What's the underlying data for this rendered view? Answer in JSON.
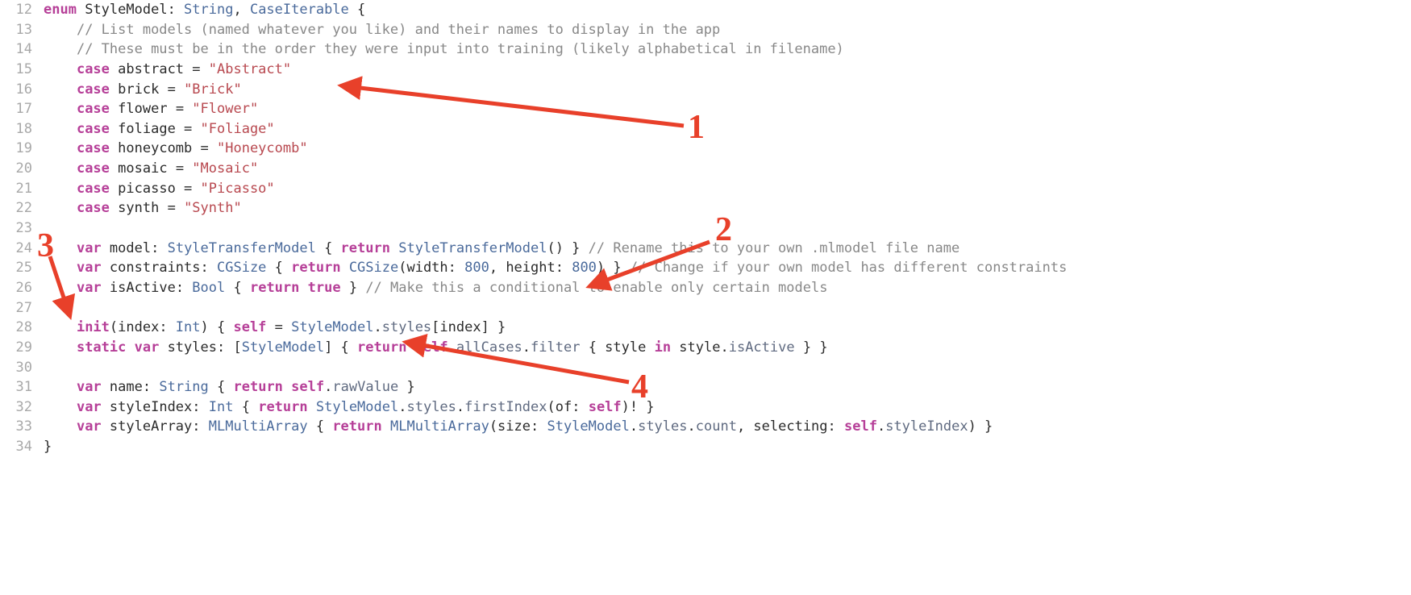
{
  "annotations": {
    "n1": "1",
    "n2": "2",
    "n3": "3",
    "n4": "4"
  },
  "colors": {
    "annotation": "#e8402a",
    "keyword": "#b63f98",
    "type": "#4a6a9b",
    "string": "#b8484f",
    "comment": "#888888"
  },
  "lines": [
    {
      "n": "12",
      "tokens": [
        {
          "c": "kw",
          "t": "enum"
        },
        {
          "c": "",
          "t": " "
        },
        {
          "c": "ident",
          "t": "StyleModel"
        },
        {
          "c": "",
          "t": ": "
        },
        {
          "c": "type",
          "t": "String"
        },
        {
          "c": "",
          "t": ", "
        },
        {
          "c": "type",
          "t": "CaseIterable"
        },
        {
          "c": "",
          "t": " {"
        }
      ]
    },
    {
      "n": "13",
      "indent": "    ",
      "tokens": [
        {
          "c": "comment",
          "t": "// List models (named whatever you like) and their names to display in the app"
        }
      ]
    },
    {
      "n": "14",
      "indent": "    ",
      "tokens": [
        {
          "c": "comment",
          "t": "// These must be in the order they were input into training (likely alphabetical in filename)"
        }
      ]
    },
    {
      "n": "15",
      "indent": "    ",
      "tokens": [
        {
          "c": "kw",
          "t": "case"
        },
        {
          "c": "",
          "t": " "
        },
        {
          "c": "ident",
          "t": "abstract"
        },
        {
          "c": "",
          "t": " = "
        },
        {
          "c": "str",
          "t": "\"Abstract\""
        }
      ]
    },
    {
      "n": "16",
      "indent": "    ",
      "tokens": [
        {
          "c": "kw",
          "t": "case"
        },
        {
          "c": "",
          "t": " "
        },
        {
          "c": "ident",
          "t": "brick"
        },
        {
          "c": "",
          "t": " = "
        },
        {
          "c": "str",
          "t": "\"Brick\""
        }
      ]
    },
    {
      "n": "17",
      "indent": "    ",
      "tokens": [
        {
          "c": "kw",
          "t": "case"
        },
        {
          "c": "",
          "t": " "
        },
        {
          "c": "ident",
          "t": "flower"
        },
        {
          "c": "",
          "t": " = "
        },
        {
          "c": "str",
          "t": "\"Flower\""
        }
      ]
    },
    {
      "n": "18",
      "indent": "    ",
      "tokens": [
        {
          "c": "kw",
          "t": "case"
        },
        {
          "c": "",
          "t": " "
        },
        {
          "c": "ident",
          "t": "foliage"
        },
        {
          "c": "",
          "t": " = "
        },
        {
          "c": "str",
          "t": "\"Foliage\""
        }
      ]
    },
    {
      "n": "19",
      "indent": "    ",
      "tokens": [
        {
          "c": "kw",
          "t": "case"
        },
        {
          "c": "",
          "t": " "
        },
        {
          "c": "ident",
          "t": "honeycomb"
        },
        {
          "c": "",
          "t": " = "
        },
        {
          "c": "str",
          "t": "\"Honeycomb\""
        }
      ]
    },
    {
      "n": "20",
      "indent": "    ",
      "tokens": [
        {
          "c": "kw",
          "t": "case"
        },
        {
          "c": "",
          "t": " "
        },
        {
          "c": "ident",
          "t": "mosaic"
        },
        {
          "c": "",
          "t": " = "
        },
        {
          "c": "str",
          "t": "\"Mosaic\""
        }
      ]
    },
    {
      "n": "21",
      "indent": "    ",
      "tokens": [
        {
          "c": "kw",
          "t": "case"
        },
        {
          "c": "",
          "t": " "
        },
        {
          "c": "ident",
          "t": "picasso"
        },
        {
          "c": "",
          "t": " = "
        },
        {
          "c": "str",
          "t": "\"Picasso\""
        }
      ]
    },
    {
      "n": "22",
      "indent": "    ",
      "tokens": [
        {
          "c": "kw",
          "t": "case"
        },
        {
          "c": "",
          "t": " "
        },
        {
          "c": "ident",
          "t": "synth"
        },
        {
          "c": "",
          "t": " = "
        },
        {
          "c": "str",
          "t": "\"Synth\""
        }
      ]
    },
    {
      "n": "23",
      "indent": "",
      "tokens": [
        {
          "c": "",
          "t": ""
        }
      ]
    },
    {
      "n": "24",
      "indent": "    ",
      "tokens": [
        {
          "c": "kw",
          "t": "var"
        },
        {
          "c": "",
          "t": " "
        },
        {
          "c": "ident",
          "t": "model"
        },
        {
          "c": "",
          "t": ": "
        },
        {
          "c": "type",
          "t": "StyleTransferModel"
        },
        {
          "c": "",
          "t": " { "
        },
        {
          "c": "kw",
          "t": "return"
        },
        {
          "c": "",
          "t": " "
        },
        {
          "c": "type",
          "t": "StyleTransferModel"
        },
        {
          "c": "",
          "t": "() } "
        },
        {
          "c": "comment",
          "t": "// Rename this to your own .mlmodel file name"
        }
      ]
    },
    {
      "n": "25",
      "indent": "    ",
      "tokens": [
        {
          "c": "kw",
          "t": "var"
        },
        {
          "c": "",
          "t": " "
        },
        {
          "c": "ident",
          "t": "constraints"
        },
        {
          "c": "",
          "t": ": "
        },
        {
          "c": "type",
          "t": "CGSize"
        },
        {
          "c": "",
          "t": " { "
        },
        {
          "c": "kw",
          "t": "return"
        },
        {
          "c": "",
          "t": " "
        },
        {
          "c": "type",
          "t": "CGSize"
        },
        {
          "c": "",
          "t": "(width: "
        },
        {
          "c": "num",
          "t": "800"
        },
        {
          "c": "",
          "t": ", height: "
        },
        {
          "c": "num",
          "t": "800"
        },
        {
          "c": "",
          "t": ") } "
        },
        {
          "c": "comment",
          "t": "// Change if your own model has different constraints"
        }
      ]
    },
    {
      "n": "26",
      "indent": "    ",
      "tokens": [
        {
          "c": "kw",
          "t": "var"
        },
        {
          "c": "",
          "t": " "
        },
        {
          "c": "ident",
          "t": "isActive"
        },
        {
          "c": "",
          "t": ": "
        },
        {
          "c": "type",
          "t": "Bool"
        },
        {
          "c": "",
          "t": " { "
        },
        {
          "c": "kw",
          "t": "return"
        },
        {
          "c": "",
          "t": " "
        },
        {
          "c": "bool",
          "t": "true"
        },
        {
          "c": "",
          "t": " } "
        },
        {
          "c": "comment",
          "t": "// Make this a conditional to enable only certain models"
        }
      ]
    },
    {
      "n": "27",
      "indent": "",
      "tokens": [
        {
          "c": "",
          "t": ""
        }
      ]
    },
    {
      "n": "28",
      "indent": "    ",
      "tokens": [
        {
          "c": "kw",
          "t": "init"
        },
        {
          "c": "",
          "t": "(index: "
        },
        {
          "c": "type",
          "t": "Int"
        },
        {
          "c": "",
          "t": ") { "
        },
        {
          "c": "kw",
          "t": "self"
        },
        {
          "c": "",
          "t": " = "
        },
        {
          "c": "type",
          "t": "StyleModel"
        },
        {
          "c": "",
          "t": "."
        },
        {
          "c": "member",
          "t": "styles"
        },
        {
          "c": "",
          "t": "[index] }"
        }
      ]
    },
    {
      "n": "29",
      "indent": "    ",
      "tokens": [
        {
          "c": "kw",
          "t": "static var"
        },
        {
          "c": "",
          "t": " "
        },
        {
          "c": "ident",
          "t": "styles"
        },
        {
          "c": "",
          "t": ": ["
        },
        {
          "c": "type",
          "t": "StyleModel"
        },
        {
          "c": "",
          "t": "] { "
        },
        {
          "c": "kw",
          "t": "return"
        },
        {
          "c": "",
          "t": " "
        },
        {
          "c": "kw",
          "t": "self"
        },
        {
          "c": "",
          "t": "."
        },
        {
          "c": "member",
          "t": "allCases"
        },
        {
          "c": "",
          "t": "."
        },
        {
          "c": "member",
          "t": "filter"
        },
        {
          "c": "",
          "t": " { style "
        },
        {
          "c": "kw",
          "t": "in"
        },
        {
          "c": "",
          "t": " style."
        },
        {
          "c": "member",
          "t": "isActive"
        },
        {
          "c": "",
          "t": " } }"
        }
      ]
    },
    {
      "n": "30",
      "indent": "",
      "tokens": [
        {
          "c": "",
          "t": ""
        }
      ]
    },
    {
      "n": "31",
      "indent": "    ",
      "tokens": [
        {
          "c": "kw",
          "t": "var"
        },
        {
          "c": "",
          "t": " "
        },
        {
          "c": "ident",
          "t": "name"
        },
        {
          "c": "",
          "t": ": "
        },
        {
          "c": "type",
          "t": "String"
        },
        {
          "c": "",
          "t": " { "
        },
        {
          "c": "kw",
          "t": "return"
        },
        {
          "c": "",
          "t": " "
        },
        {
          "c": "kw",
          "t": "self"
        },
        {
          "c": "",
          "t": "."
        },
        {
          "c": "member",
          "t": "rawValue"
        },
        {
          "c": "",
          "t": " }"
        }
      ]
    },
    {
      "n": "32",
      "indent": "    ",
      "tokens": [
        {
          "c": "kw",
          "t": "var"
        },
        {
          "c": "",
          "t": " "
        },
        {
          "c": "ident",
          "t": "styleIndex"
        },
        {
          "c": "",
          "t": ": "
        },
        {
          "c": "type",
          "t": "Int"
        },
        {
          "c": "",
          "t": " { "
        },
        {
          "c": "kw",
          "t": "return"
        },
        {
          "c": "",
          "t": " "
        },
        {
          "c": "type",
          "t": "StyleModel"
        },
        {
          "c": "",
          "t": "."
        },
        {
          "c": "member",
          "t": "styles"
        },
        {
          "c": "",
          "t": "."
        },
        {
          "c": "member",
          "t": "firstIndex"
        },
        {
          "c": "",
          "t": "(of: "
        },
        {
          "c": "kw",
          "t": "self"
        },
        {
          "c": "",
          "t": ")! }"
        }
      ]
    },
    {
      "n": "33",
      "indent": "    ",
      "tokens": [
        {
          "c": "kw",
          "t": "var"
        },
        {
          "c": "",
          "t": " "
        },
        {
          "c": "ident",
          "t": "styleArray"
        },
        {
          "c": "",
          "t": ": "
        },
        {
          "c": "type",
          "t": "MLMultiArray"
        },
        {
          "c": "",
          "t": " { "
        },
        {
          "c": "kw",
          "t": "return"
        },
        {
          "c": "",
          "t": " "
        },
        {
          "c": "type",
          "t": "MLMultiArray"
        },
        {
          "c": "",
          "t": "(size: "
        },
        {
          "c": "type",
          "t": "StyleModel"
        },
        {
          "c": "",
          "t": "."
        },
        {
          "c": "member",
          "t": "styles"
        },
        {
          "c": "",
          "t": "."
        },
        {
          "c": "member",
          "t": "count"
        },
        {
          "c": "",
          "t": ", selecting: "
        },
        {
          "c": "kw",
          "t": "self"
        },
        {
          "c": "",
          "t": "."
        },
        {
          "c": "member",
          "t": "styleIndex"
        },
        {
          "c": "",
          "t": ") }"
        }
      ]
    },
    {
      "n": "34",
      "indent": "",
      "tokens": [
        {
          "c": "",
          "t": "}"
        }
      ]
    }
  ]
}
